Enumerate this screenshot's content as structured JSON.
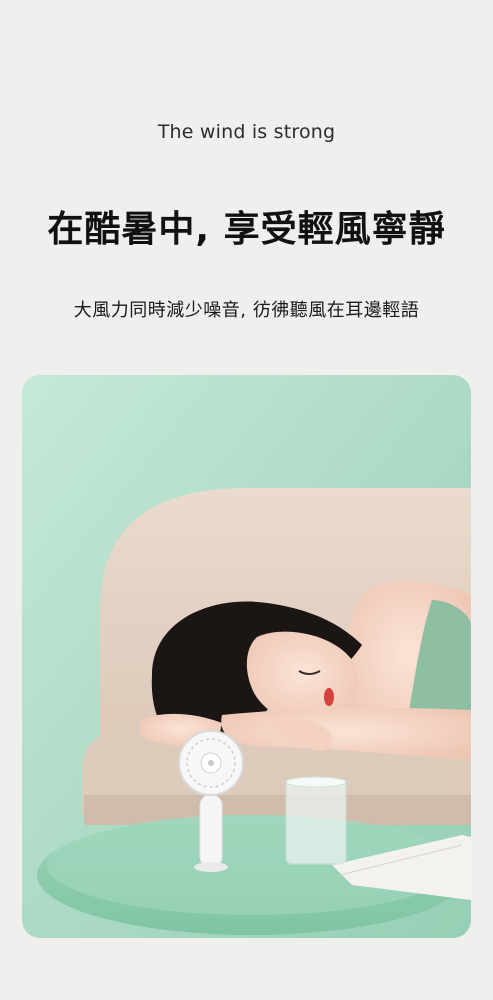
{
  "hero": {
    "tagline": "The wind is strong",
    "headline": "在酷暑中, 享受輕風寧靜",
    "subline": "大風力同時減少噪音, 彷彿聽風在耳邊輕語"
  },
  "photo": {
    "scene": "woman sleeping on sofa beside handheld fan",
    "colors": {
      "wall": "#a9d9c3",
      "sofa": "#e4d3c5",
      "table": "#8fcdb1",
      "fan": "#f5f5f5"
    }
  }
}
